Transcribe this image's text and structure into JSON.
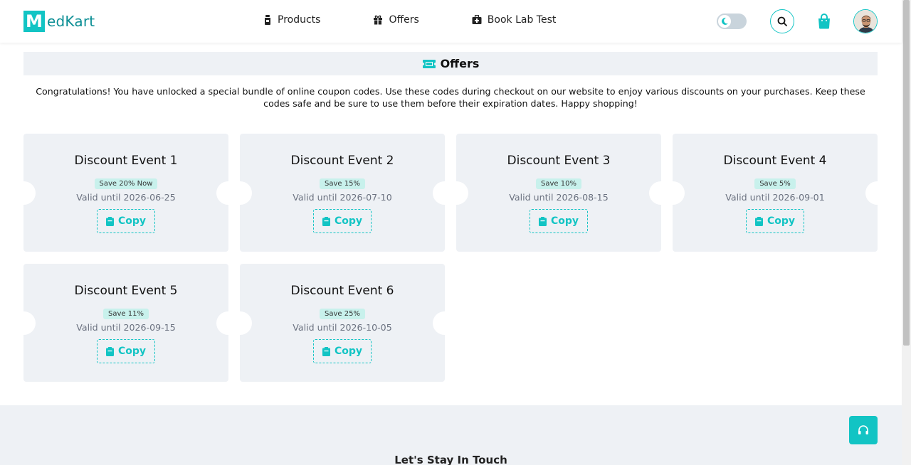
{
  "brand": {
    "logo_letter": "M",
    "name": "edKart",
    "color": "#12c4c4"
  },
  "nav": {
    "items": [
      {
        "label": "Products",
        "icon": "bottle-icon"
      },
      {
        "label": "Offers",
        "icon": "gift-icon"
      },
      {
        "label": "Book Lab Test",
        "icon": "medical-kit-icon"
      }
    ]
  },
  "header_actions": {
    "theme_toggle": "moon-icon",
    "search": "search-icon",
    "cart": "shopping-bag-icon",
    "avatar": "user-avatar"
  },
  "page": {
    "title": "Offers",
    "title_icon": "ticket-icon",
    "intro": "Congratulations! You have unlocked a special bundle of online coupon codes. Use these codes during checkout on our website to enjoy various discounts on your purchases. Keep these codes safe and be sure to use them before their expiration dates. Happy shopping!"
  },
  "coupons": [
    {
      "title": "Discount Event 1",
      "badge": "Save 20% Now",
      "valid": "Valid until 2026-06-25",
      "copy_label": "Copy"
    },
    {
      "title": "Discount Event 2",
      "badge": "Save 15%",
      "valid": "Valid until 2026-07-10",
      "copy_label": "Copy"
    },
    {
      "title": "Discount Event 3",
      "badge": "Save 10%",
      "valid": "Valid until 2026-08-15",
      "copy_label": "Copy"
    },
    {
      "title": "Discount Event 4",
      "badge": "Save 5%",
      "valid": "Valid until 2026-09-01",
      "copy_label": "Copy"
    },
    {
      "title": "Discount Event 5",
      "badge": "Save 11%",
      "valid": "Valid until 2026-09-15",
      "copy_label": "Copy"
    },
    {
      "title": "Discount Event 6",
      "badge": "Save 25%",
      "valid": "Valid until 2026-10-05",
      "copy_label": "Copy"
    }
  ],
  "footer": {
    "title": "Let's Stay In Touch",
    "support_icon": "headset-icon"
  }
}
